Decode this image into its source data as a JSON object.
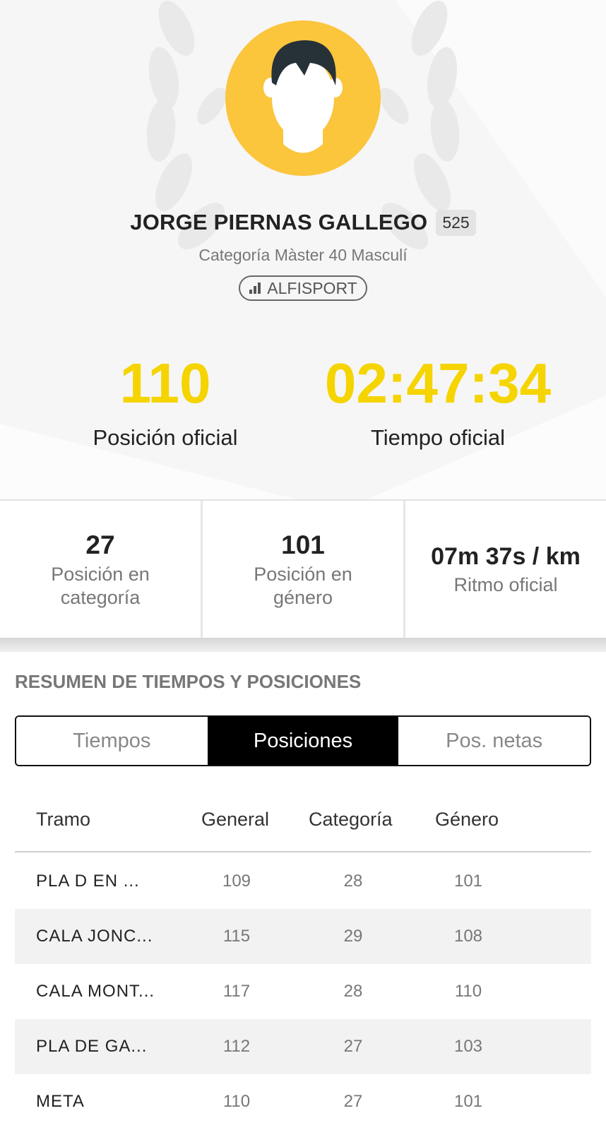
{
  "athlete": {
    "name": "JORGE PIERNAS GALLEGO",
    "bib": "525",
    "category": "Categoría Màster 40 Masculí",
    "timer": "ALFISPORT"
  },
  "official": {
    "position_value": "110",
    "position_label": "Posición oficial",
    "time_value": "02:47:34",
    "time_label": "Tiempo oficial"
  },
  "stats": [
    {
      "value": "27",
      "label_line1": "Posición en",
      "label_line2": "categoría"
    },
    {
      "value": "101",
      "label_line1": "Posición en",
      "label_line2": "género"
    },
    {
      "value": "07m 37s / km",
      "label_line1": "Ritmo oficial",
      "label_line2": ""
    }
  ],
  "summary": {
    "title": "RESUMEN DE TIEMPOS Y POSICIONES",
    "tabs": [
      "Tiempos",
      "Posiciones",
      "Pos. netas"
    ],
    "active_tab": "Posiciones"
  },
  "table": {
    "headers": [
      "Tramo",
      "General",
      "Categoría",
      "Género"
    ],
    "rows": [
      [
        "PLA D EN ...",
        "109",
        "28",
        "101"
      ],
      [
        "CALA JONC...",
        "115",
        "29",
        "108"
      ],
      [
        "CALA MONT...",
        "117",
        "28",
        "110"
      ],
      [
        "PLA DE GA...",
        "112",
        "27",
        "103"
      ],
      [
        "META",
        "110",
        "27",
        "101"
      ]
    ]
  },
  "colors": {
    "accent_yellow": "#f5d400",
    "avatar_yellow": "#fbc53c",
    "active_tab": "#000000"
  },
  "icons": [
    "laurel-wreath-icon",
    "user-avatar-icon",
    "signal-bars-icon"
  ]
}
